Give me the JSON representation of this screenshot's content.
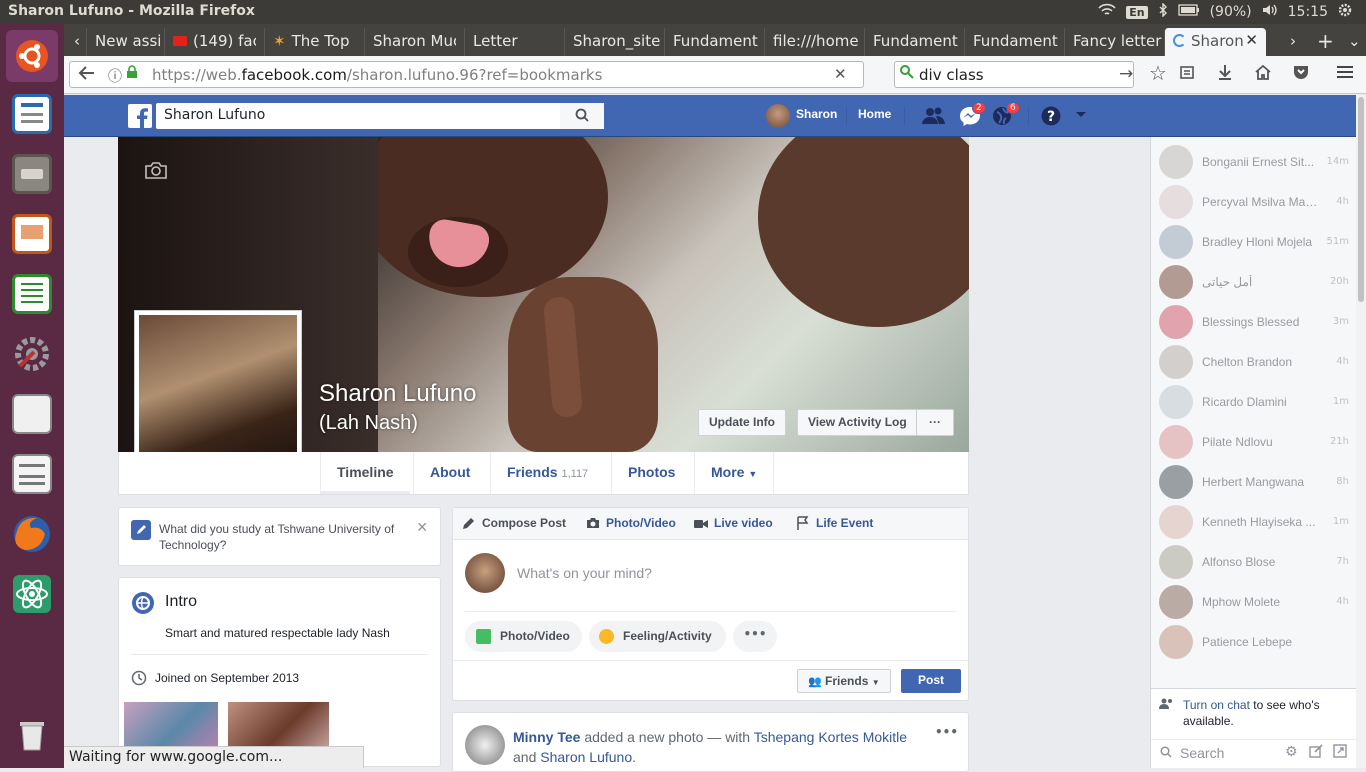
{
  "window": {
    "title": "Sharon Lufuno - Mozilla Firefox"
  },
  "tray": {
    "lang": "En",
    "battery": "(90%)",
    "time": "15:15"
  },
  "tabs": [
    {
      "label": "New assi"
    },
    {
      "label": "(149) fac"
    },
    {
      "label": "The Top"
    },
    {
      "label": "Sharon Muc"
    },
    {
      "label": "Letter"
    },
    {
      "label": "Sharon_site"
    },
    {
      "label": "Fundament"
    },
    {
      "label": "file:///home"
    },
    {
      "label": "Fundament"
    },
    {
      "label": "Fundament"
    },
    {
      "label": "Fancy letter"
    },
    {
      "label": "Sharon"
    }
  ],
  "nav": {
    "url_prefix": "https://web.",
    "url_domain": "facebook.com",
    "url_path": "/sharon.lufuno.96?ref=bookmarks",
    "search_value": "div class"
  },
  "fb": {
    "search_value": "Sharon Lufuno",
    "user": "Sharon",
    "home": "Home",
    "messages_badge": "2",
    "notifications_badge": "6"
  },
  "profile": {
    "name": "Sharon Lufuno",
    "alt_name": "(Lah Nash)",
    "update_info": "Update Info",
    "activity_log": "View Activity Log",
    "more_dots": "···"
  },
  "timeline_tabs": {
    "timeline": "Timeline",
    "about": "About",
    "friends": "Friends",
    "friends_count": "1,117",
    "photos": "Photos",
    "more": "More"
  },
  "study_prompt": "What did you study at Tshwane University of Technology?",
  "intro": {
    "title": "Intro",
    "bio": "Smart and matured respectable lady Nash",
    "joined": "Joined on September 2013"
  },
  "composer": {
    "compose": "Compose Post",
    "photo_video": "Photo/Video",
    "live_video": "Live video",
    "life_event": "Life Event",
    "placeholder": "What's on your mind?",
    "photo_btn": "Photo/Video",
    "feeling_btn": "Feeling/Activity",
    "audience": "Friends",
    "post": "Post"
  },
  "feed_post": {
    "author": "Minny Tee",
    "action": "added a new photo — with",
    "tagged1": "Tshepang Kortes Mokitle",
    "and": "and",
    "tagged2": "Sharon Lufuno",
    "dot": "."
  },
  "chat": {
    "contacts": [
      {
        "name": "Bonganii Ernest Sit...",
        "time": "14m"
      },
      {
        "name": "Percyval Msilva Mab...",
        "time": "4h"
      },
      {
        "name": "Bradley Hloni Mojela",
        "time": "51m"
      },
      {
        "name": "أمل حياتى",
        "time": "20h"
      },
      {
        "name": "Blessings Blessed",
        "time": "3m"
      },
      {
        "name": "Chelton Brandon",
        "time": "4h"
      },
      {
        "name": "Ricardo Dlamini",
        "time": "1m"
      },
      {
        "name": "Pilate Ndlovu",
        "time": "21h"
      },
      {
        "name": "Herbert Mangwana",
        "time": "8h"
      },
      {
        "name": "Kenneth Hlayiseka ...",
        "time": "1m"
      },
      {
        "name": "Alfonso Blose",
        "time": "7h"
      },
      {
        "name": "Mphow Molete",
        "time": "4h"
      },
      {
        "name": "Patience Lebepe",
        "time": ""
      }
    ],
    "turn_on": "Turn on chat",
    "turn_on_rest": "to see who's available.",
    "search_placeholder": "Search"
  },
  "status": "Waiting for www.google.com..."
}
